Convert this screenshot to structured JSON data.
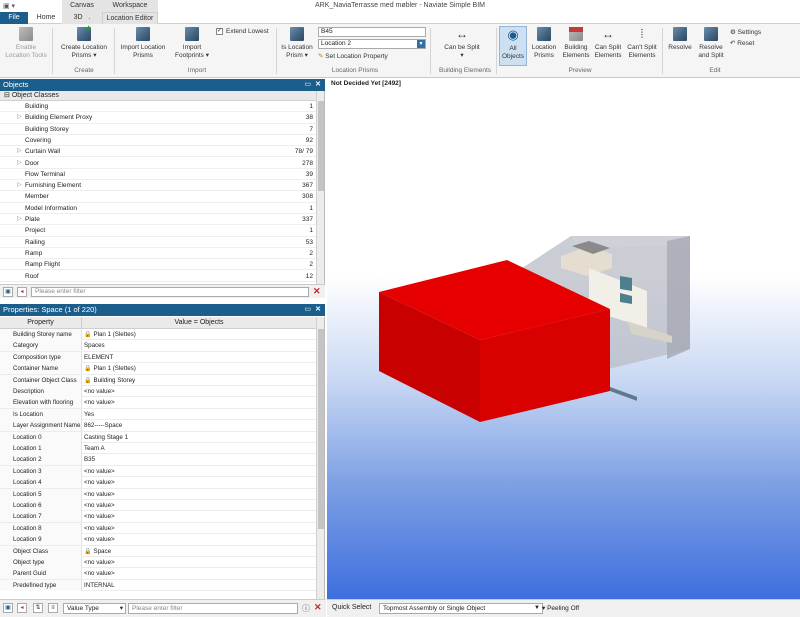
{
  "window": {
    "title": "ARK_NaviaTerrasse med møbler - Naviate Simple BIM",
    "context_groups": [
      "Canvas",
      "Workspace"
    ]
  },
  "tabs": [
    "File",
    "Home",
    "3D",
    "Location Editor"
  ],
  "tab_dot": ".",
  "ribbon": {
    "enable_location_tools": "Enable Location Tools",
    "create_location_prisms": "Create Location Prisms",
    "group_create": "Create",
    "import_location_prisms": "Import Location Prisms",
    "import_footprints": "Import Footprints",
    "extend_lowest": "Extend Lowest",
    "group_import": "Import",
    "is_location_prism": "Is Location Prism",
    "location_value": "B45",
    "location_select": "Location 2",
    "set_location_property": "Set Location Property",
    "group_location_prisms": "Location Prisms",
    "can_be_split": "Can be Split",
    "group_building_elements": "Building Elements",
    "all_objects": "All Objects",
    "location_prisms": "Location Prisms",
    "building_elements": "Building Elements",
    "can_split_elements": "Can Split Elements",
    "cant_split_elements": "Can't Split Elements",
    "group_preview": "Preview",
    "resolve": "Resolve",
    "resolve_and_split": "Resolve and Split",
    "settings": "Settings",
    "reset": "Reset",
    "group_edit": "Edit"
  },
  "objects_panel": {
    "title": "Objects",
    "root": "Object Classes",
    "rows": [
      {
        "name": "Building",
        "count": "1",
        "expandable": false
      },
      {
        "name": "Building Element Proxy",
        "count": "38",
        "expandable": true
      },
      {
        "name": "Building Storey",
        "count": "7",
        "expandable": false
      },
      {
        "name": "Covering",
        "count": "92",
        "expandable": false
      },
      {
        "name": "Curtain Wall",
        "count": "78/ 79",
        "expandable": true
      },
      {
        "name": "Door",
        "count": "278",
        "expandable": true
      },
      {
        "name": "Flow Terminal",
        "count": "39",
        "expandable": false
      },
      {
        "name": "Furnishing Element",
        "count": "367",
        "expandable": true
      },
      {
        "name": "Member",
        "count": "308",
        "expandable": false
      },
      {
        "name": "Model Information",
        "count": "1",
        "expandable": false
      },
      {
        "name": "Plate",
        "count": "337",
        "expandable": true
      },
      {
        "name": "Project",
        "count": "1",
        "expandable": false
      },
      {
        "name": "Railing",
        "count": "53",
        "expandable": false
      },
      {
        "name": "Ramp",
        "count": "2",
        "expandable": false
      },
      {
        "name": "Ramp Flight",
        "count": "2",
        "expandable": false
      },
      {
        "name": "Roof",
        "count": "12",
        "expandable": false
      }
    ],
    "filter_placeholder": "Please enter filter"
  },
  "properties_panel": {
    "title": "Properties: Space (1 of 220)",
    "col_property": "Property",
    "col_value": "Value = Objects",
    "rows": [
      {
        "k": "Building Storey name",
        "v": "Plan 1 (Slettes)",
        "lock": true
      },
      {
        "k": "Category",
        "v": "Spaces",
        "lock": false
      },
      {
        "k": "Composition type",
        "v": "ELEMENT",
        "lock": false
      },
      {
        "k": "Container Name",
        "v": "Plan 1 (Slettes)",
        "lock": true
      },
      {
        "k": "Container Object Class",
        "v": "Building Storey",
        "lock": true
      },
      {
        "k": "Description",
        "v": "<no value>",
        "lock": false
      },
      {
        "k": "Elevation with flooring",
        "v": "<no value>",
        "lock": false
      },
      {
        "k": "Is Location",
        "v": "Yes",
        "lock": false
      },
      {
        "k": "Layer Assignment Name",
        "v": "862-----Space",
        "lock": false
      },
      {
        "k": "Location 0",
        "v": "Casting Stage 1",
        "lock": false
      },
      {
        "k": "Location 1",
        "v": "Team A",
        "lock": false
      },
      {
        "k": "Location 2",
        "v": "B35",
        "lock": false
      },
      {
        "k": "Location 3",
        "v": "<no value>",
        "lock": false
      },
      {
        "k": "Location 4",
        "v": "<no value>",
        "lock": false
      },
      {
        "k": "Location 5",
        "v": "<no value>",
        "lock": false
      },
      {
        "k": "Location 6",
        "v": "<no value>",
        "lock": false
      },
      {
        "k": "Location 7",
        "v": "<no value>",
        "lock": false
      },
      {
        "k": "Location 8",
        "v": "<no value>",
        "lock": false
      },
      {
        "k": "Location 9",
        "v": "<no value>",
        "lock": false
      },
      {
        "k": "Object Class",
        "v": "Space",
        "lock": true
      },
      {
        "k": "Object type",
        "v": "<no value>",
        "lock": false
      },
      {
        "k": "Parent Guid",
        "v": "<no value>",
        "lock": false
      },
      {
        "k": "Predefined type",
        "v": "INTERNAL",
        "lock": false
      }
    ],
    "value_type": "Value Type",
    "filter_placeholder": "Please enter filter"
  },
  "viewport": {
    "label": "Not Decided Yet [2492]",
    "quick_select_label": "Quick Select",
    "quick_select_value": "Topmost Assembly or Single Object",
    "peeling": "Peeling Off"
  },
  "colors": {
    "accent": "#1b5e8c",
    "prism_red": "#d40000",
    "sky_blue": "#3e6fde"
  }
}
